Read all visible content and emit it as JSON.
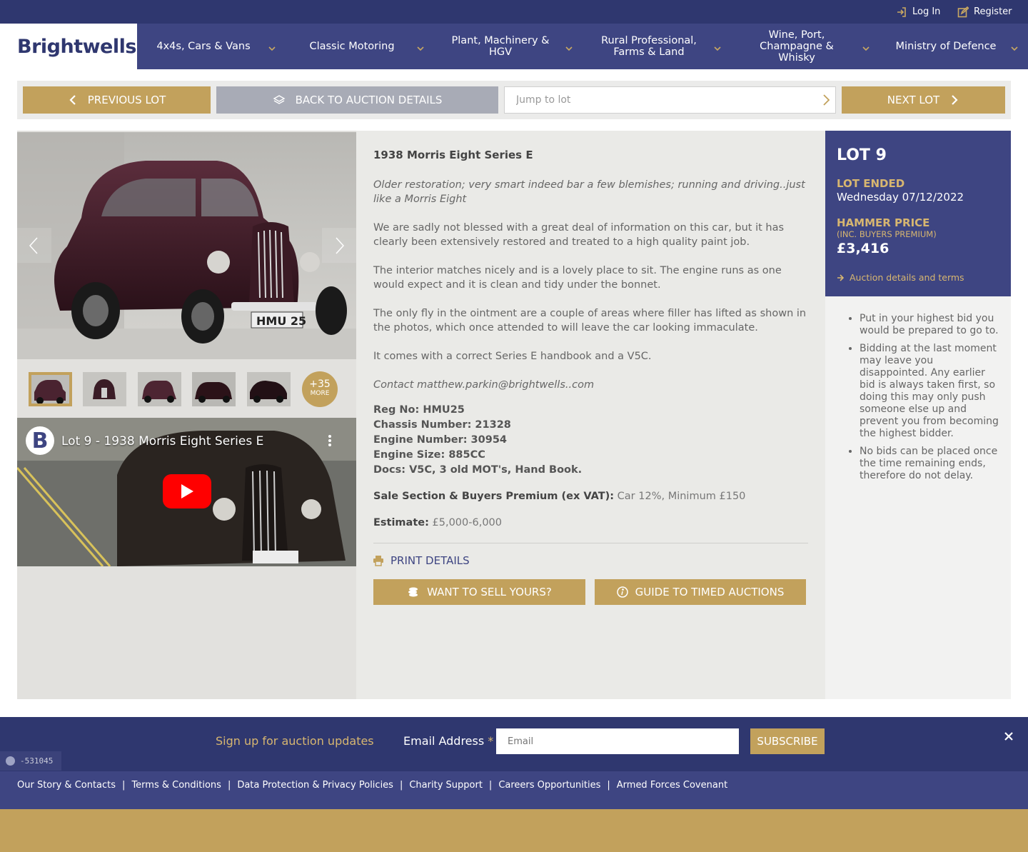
{
  "topbar": {
    "login": "Log In",
    "register": "Register"
  },
  "brand": {
    "logo": "Brightwells"
  },
  "nav": {
    "items": [
      {
        "label": "4x4s, Cars & Vans"
      },
      {
        "label": "Classic Motoring"
      },
      {
        "label": "Plant, Machinery & HGV"
      },
      {
        "label": "Rural Professional, Farms & Land"
      },
      {
        "label": "Wine, Port, Champagne & Whisky"
      },
      {
        "label": "Ministry of Defence"
      }
    ]
  },
  "lotnav": {
    "previous": "Previous Lot",
    "back": "Back to Auction Details",
    "jump_placeholder": "Jump to lot",
    "next": "Next Lot"
  },
  "gallery": {
    "more_count": "+35",
    "more_label": "MORE"
  },
  "video": {
    "badge": "B",
    "title": "Lot 9 - 1938 Morris Eight Series E"
  },
  "lot": {
    "title": "1938 Morris Eight Series E",
    "summary": "Older restoration; very smart indeed bar a few blemishes; running and driving..just like a Morris Eight",
    "paragraphs": [
      "We are sadly not blessed with a great deal of information on this car, but it has clearly been extensively restored and treated to a high quality paint job.",
      "The interior matches nicely and is a lovely place to sit. The engine runs as one would expect and it is clean and tidy under the bonnet.",
      "The only fly in the ointment are a couple of areas where filler has lifted as shown in the photos, which once attended to will leave the car looking immaculate.",
      "It comes with a correct Series E handbook and a V5C."
    ],
    "contact": "Contact matthew.parkin@brightwells..com",
    "specs": [
      "Reg No: HMU25",
      "Chassis Number: 21328",
      "Engine Number: 30954",
      "Engine Size: 885CC",
      "Docs: V5C, 3 old MOT's, Hand Book."
    ],
    "premium_label": "Sale Section & Buyers Premium (ex VAT):",
    "premium_value": "Car 12%, Minimum £150",
    "estimate_label": "Estimate:",
    "estimate_value": "£5,000-6,000",
    "print": "Print Details",
    "sell_button": "Want to sell yours?",
    "guide_button": "Guide to Timed Auctions"
  },
  "status": {
    "lot_number": "LOT 9",
    "ended_label": "LOT ENDED",
    "ended_date": "Wednesday 07/12/2022",
    "hammer_label": "HAMMER PRICE",
    "hammer_sub": "(INC. BUYERS PREMIUM)",
    "hammer_value": "£3,416",
    "terms_link": "Auction details and terms"
  },
  "tips": [
    "Put in your highest bid you would be prepared to go to.",
    "Bidding at the last moment may leave you disappointed. Any earlier bid is always taken first, so doing this may only push someone else up and prevent you from becoming the highest bidder.",
    "No bids can be placed once the time remaining ends, therefore do not delay."
  ],
  "newsletter": {
    "heading": "Sign up for auction updates",
    "email_label": "Email Address",
    "required_mark": "*",
    "email_placeholder": "Email",
    "subscribe": "Subscribe"
  },
  "debug": {
    "value": "-531045"
  },
  "footer": {
    "links": [
      "Our Story & Contacts",
      "Terms & Conditions",
      "Data Protection & Privacy Policies",
      "Charity Support",
      "Careers Opportunities",
      "Armed Forces Covenant"
    ],
    "separator": "|"
  },
  "colors": {
    "navy": "#2f376f",
    "nav_blue": "#3e4582",
    "gold": "#c2a15c",
    "grey_button": "#a8abb6"
  }
}
